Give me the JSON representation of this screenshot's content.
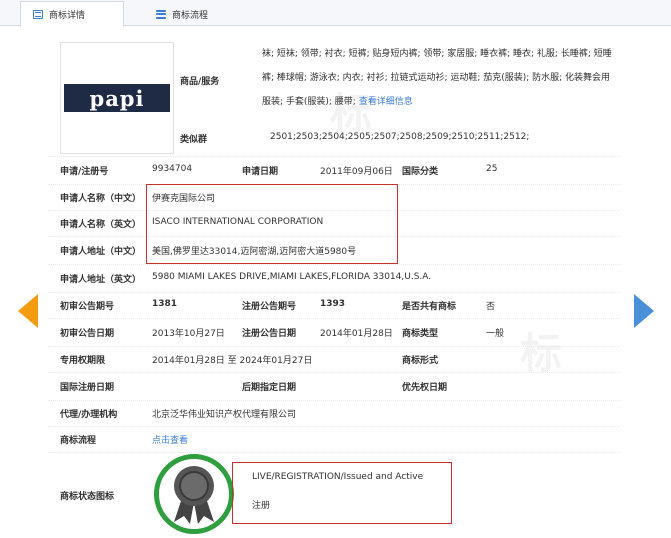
{
  "tabs": [
    {
      "label": "商标详情",
      "icon": "document-icon",
      "active": true
    },
    {
      "label": "商标流程",
      "icon": "list-icon",
      "active": false
    }
  ],
  "logo": {
    "text": "papi"
  },
  "goods": {
    "label": "商品/服务",
    "text": "袜; 短袜; 领带; 衬衣; 短裤; 贴身短内裤; 领带; 家居服; 睡衣裤; 睡衣; 礼服; 长睡裤; 短睡裤; 棒球帽; 游泳衣; 内衣; 衬衫; 拉链式运动衫; 运动鞋; 茄克(服装); 防水服; 化装舞会用服装; 手套(服装); 腰带;",
    "detail_link": "查看详细信息"
  },
  "similar_group": {
    "label": "类似群",
    "value": "2501;2503;2504;2505;2507;2508;2509;2510;2511;2512;"
  },
  "fields": {
    "reg_no_label": "申请/注册号",
    "reg_no": "9934704",
    "app_date_label": "申请日期",
    "app_date": "2011年09月06日",
    "intl_class_label": "国际分类",
    "intl_class": "25",
    "applicant_cn_label": "申请人名称（中文）",
    "applicant_cn": "伊赛克国际公司",
    "applicant_en_label": "申请人名称（英文）",
    "applicant_en": "ISACO INTERNATIONAL CORPORATION",
    "address_cn_label": "申请人地址（中文）",
    "address_cn": "美国,佛罗里达33014,迈阿密湖,迈阿密大道5980号",
    "address_en_label": "申请人地址（英文）",
    "address_en": "5980 MIAMI LAKES DRIVE,MIAMI LAKES,FLORIDA 33014,U.S.A.",
    "prelim_no_label": "初审公告期号",
    "prelim_no": "1381",
    "reg_pub_no_label": "注册公告期号",
    "reg_pub_no": "1393",
    "shared_label": "是否共有商标",
    "shared": "否",
    "prelim_date_label": "初审公告日期",
    "prelim_date": "2013年10月27日",
    "reg_pub_date_label": "注册公告日期",
    "reg_pub_date": "2014年01月28日",
    "mark_type_label": "商标类型",
    "mark_type": "一般",
    "exclusive_label": "专用权期限",
    "exclusive": "2014年01月28日 至 2024年01月27日",
    "mark_form_label": "商标形式",
    "mark_form": "",
    "intl_reg_date_label": "国际注册日期",
    "intl_reg_date": "",
    "later_date_label": "后期指定日期",
    "later_date": "",
    "priority_label": "优先权日期",
    "priority": "",
    "agent_label": "代理/办理机构",
    "agent": "北京泛华伟业知识产权代理有限公司",
    "process_label": "商标流程",
    "process_link": "点击查看",
    "status_label": "商标状态图标"
  },
  "status": {
    "line1": "LIVE/REGISTRATION/Issued and Active",
    "line2": "注册"
  },
  "colors": {
    "link": "#3a7bd5",
    "highlight_box": "#c9302c",
    "badge_ring": "#2e9e3e",
    "nav_left": "#f39c12",
    "nav_right": "#4a90d9"
  }
}
